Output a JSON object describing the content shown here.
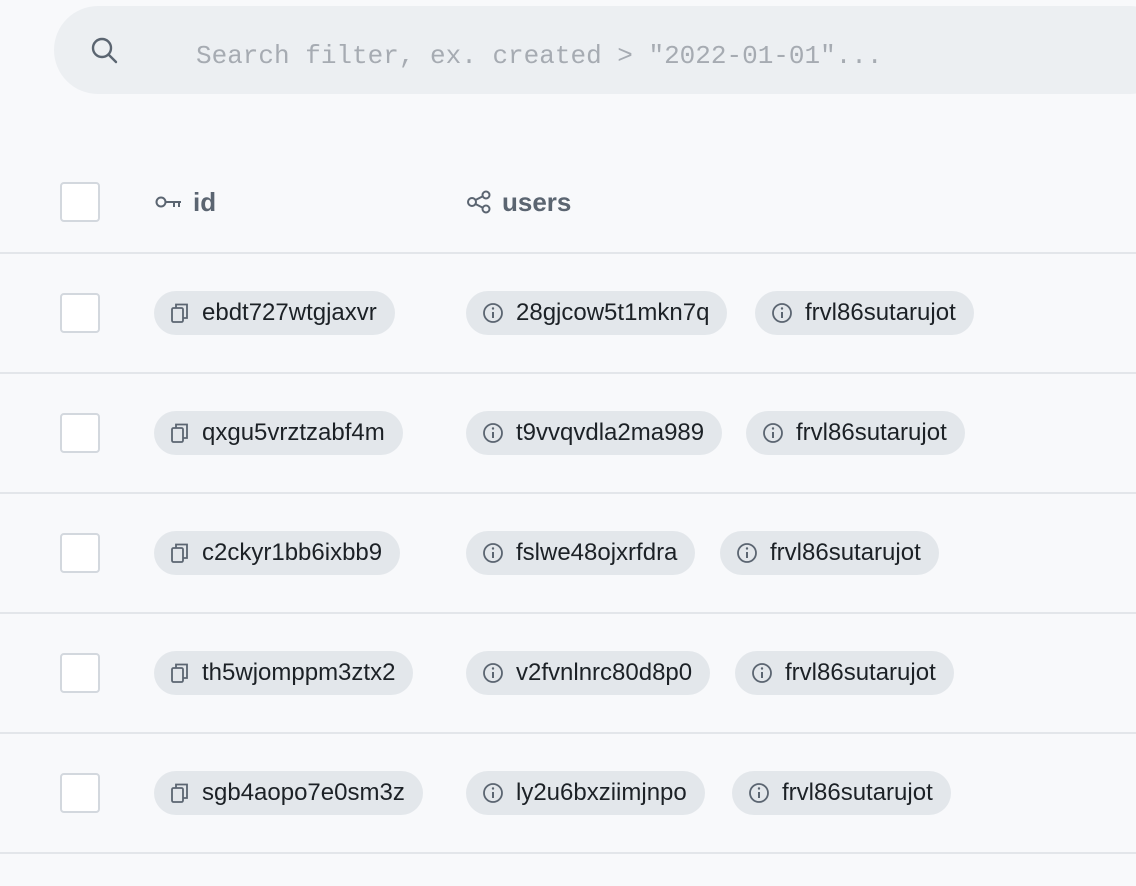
{
  "search": {
    "placeholder": "Search filter, ex. created > \"2022-01-01\"..."
  },
  "columns": {
    "id": "id",
    "users": "users"
  },
  "rows": [
    {
      "id": "ebdt727wtgjaxvr",
      "users": [
        "28gjcow5t1mkn7q",
        "frvl86sutarujot"
      ]
    },
    {
      "id": "qxgu5vrztzabf4m",
      "users": [
        "t9vvqvdla2ma989",
        "frvl86sutarujot"
      ]
    },
    {
      "id": "c2ckyr1bb6ixbb9",
      "users": [
        "fslwe48ojxrfdra",
        "frvl86sutarujot"
      ]
    },
    {
      "id": "th5wjomppm3ztx2",
      "users": [
        "v2fvnlnrc80d8p0",
        "frvl86sutarujot"
      ]
    },
    {
      "id": "sgb4aopo7e0sm3z",
      "users": [
        "ly2u6bxziimjnpo",
        "frvl86sutarujot"
      ]
    }
  ]
}
